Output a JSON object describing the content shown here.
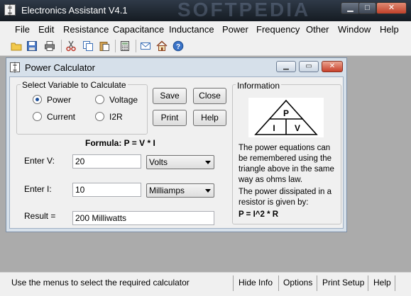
{
  "window": {
    "title": "Electronics Assistant V4.1",
    "watermark": "SOFTPEDIA"
  },
  "menu": [
    "File",
    "Edit",
    "Resistance",
    "Capacitance",
    "Inductance",
    "Power",
    "Frequency",
    "Other",
    "Window",
    "Help"
  ],
  "toolbar": [
    "open-folder-icon",
    "save-icon",
    "print-icon",
    "cut-icon",
    "copy-icon",
    "paste-icon",
    "calculator-icon",
    "email-icon",
    "home-icon",
    "help-icon"
  ],
  "dialog": {
    "title": "Power Calculator",
    "group_title": "Select Variable to Calculate",
    "radios": [
      {
        "label": "Power",
        "checked": true
      },
      {
        "label": "Voltage",
        "checked": false
      },
      {
        "label": "Current",
        "checked": false
      },
      {
        "label": "I2R",
        "checked": false
      }
    ],
    "buttons": {
      "save": "Save",
      "close": "Close",
      "print": "Print",
      "help": "Help"
    },
    "formula": "Formula: P = V * I",
    "input_v": {
      "label": "Enter V:",
      "value": "20",
      "unit": "Volts"
    },
    "input_i": {
      "label": "Enter I:",
      "value": "10",
      "unit": "Milliamps"
    },
    "result": {
      "label": "Result =",
      "value": "200 Milliwatts"
    },
    "info": {
      "title": "Information",
      "triangle": {
        "top": "P",
        "left": "I",
        "right": "V"
      },
      "text1": "The power equations can be remembered using the triangle above in the same way as ohms law.",
      "text2": "The power dissipated in a resistor is given by:",
      "formula": "P = I^2 * R"
    }
  },
  "status": {
    "message": "Use the menus to select the required calculator",
    "hide_info": "Hide Info",
    "options": "Options",
    "print_setup": "Print Setup",
    "help": "Help"
  }
}
